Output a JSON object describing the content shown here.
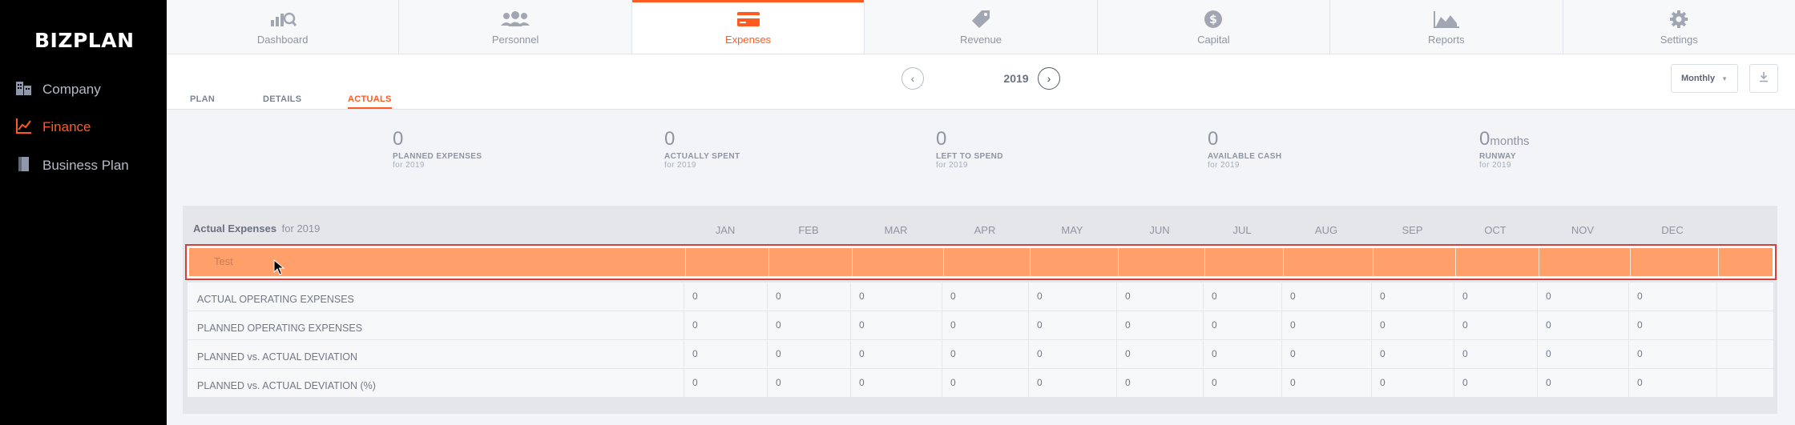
{
  "brand": "BIZPLAN",
  "sidebar": {
    "items": [
      {
        "label": "Company",
        "icon": "building-icon",
        "active": false
      },
      {
        "label": "Finance",
        "icon": "chart-line-icon",
        "active": true
      },
      {
        "label": "Business Plan",
        "icon": "book-icon",
        "active": false
      }
    ]
  },
  "topnav": {
    "tabs": [
      {
        "label": "Dashboard",
        "icon": "dashboard-icon"
      },
      {
        "label": "Personnel",
        "icon": "people-icon"
      },
      {
        "label": "Expenses",
        "icon": "credit-card-icon",
        "active": true
      },
      {
        "label": "Revenue",
        "icon": "tag-icon"
      },
      {
        "label": "Capital",
        "icon": "dollar-icon"
      },
      {
        "label": "Reports",
        "icon": "area-chart-icon"
      },
      {
        "label": "Settings",
        "icon": "gear-icon"
      }
    ]
  },
  "subheader": {
    "tabs": [
      "PLAN",
      "DETAILS",
      "ACTUALS"
    ],
    "active_tab": "ACTUALS",
    "year": "2019",
    "period": "Monthly"
  },
  "kpis": [
    {
      "value": "0",
      "unit": "",
      "label": "PLANNED EXPENSES",
      "sub": "for 2019"
    },
    {
      "value": "0",
      "unit": "",
      "label": "ACTUALLY SPENT",
      "sub": "for 2019"
    },
    {
      "value": "0",
      "unit": "",
      "label": "LEFT TO SPEND",
      "sub": "for 2019"
    },
    {
      "value": "0",
      "unit": "",
      "label": "AVAILABLE CASH",
      "sub": "for 2019"
    },
    {
      "value": "0",
      "unit": "months",
      "label": "RUNWAY",
      "sub": "for 2019"
    }
  ],
  "table": {
    "title": "Actual Expenses",
    "title_suffix": "for 2019",
    "months": [
      "JAN",
      "FEB",
      "MAR",
      "APR",
      "MAY",
      "JUN",
      "JUL",
      "AUG",
      "SEP",
      "OCT",
      "NOV",
      "DEC"
    ],
    "selected_row": "Test",
    "rows": [
      {
        "label": "ACTUAL OPERATING EXPENSES",
        "values": [
          "0",
          "0",
          "0",
          "0",
          "0",
          "0",
          "0",
          "0",
          "0",
          "0",
          "0",
          "0"
        ]
      },
      {
        "label": "PLANNED OPERATING EXPENSES",
        "values": [
          "0",
          "0",
          "0",
          "0",
          "0",
          "0",
          "0",
          "0",
          "0",
          "0",
          "0",
          "0"
        ]
      },
      {
        "label": "PLANNED vs. ACTUAL DEVIATION",
        "values": [
          "0",
          "0",
          "0",
          "0",
          "0",
          "0",
          "0",
          "0",
          "0",
          "0",
          "0",
          "0"
        ]
      },
      {
        "label": "PLANNED vs. ACTUAL DEVIATION (%)",
        "values": [
          "0",
          "0",
          "0",
          "0",
          "0",
          "0",
          "0",
          "0",
          "0",
          "0",
          "0",
          "0"
        ]
      }
    ]
  },
  "colors": {
    "accent": "#ff5a1f",
    "selected_row": "#ffa06a",
    "selection_border": "#d4403a"
  }
}
